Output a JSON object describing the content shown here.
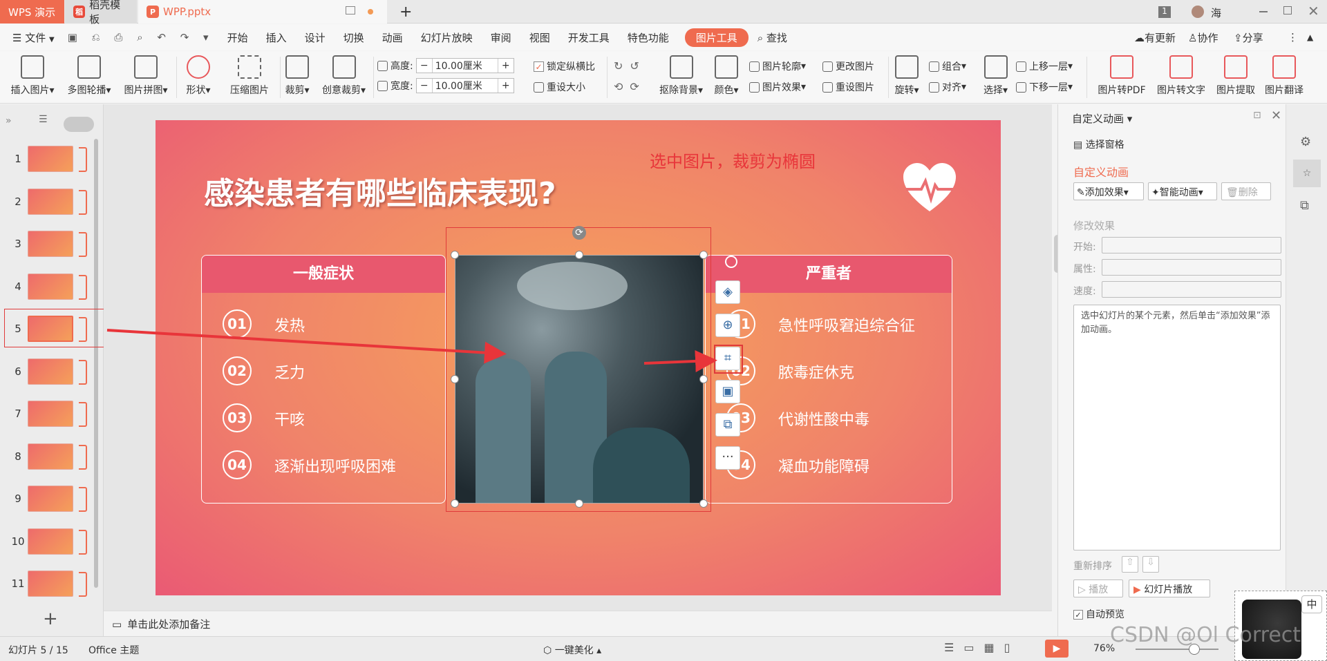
{
  "titlebar": {
    "app_tab": "WPS 演示",
    "tab2": "稻壳模板",
    "tab3": "WPP.pptx",
    "new_tab": "+",
    "badge": "1",
    "user": "海"
  },
  "menu": {
    "file": "文件",
    "items": [
      "开始",
      "插入",
      "设计",
      "切换",
      "动画",
      "幻灯片放映",
      "审阅",
      "视图",
      "开发工具",
      "特色功能"
    ],
    "active": "图片工具",
    "search": "查找",
    "update": "有更新",
    "collab": "协作",
    "share": "分享"
  },
  "ribbon": {
    "insert_pic": "插入图片",
    "carousel": "多图轮播",
    "collage": "图片拼图",
    "shape": "形状",
    "compress": "压缩图片",
    "crop": "裁剪",
    "creative_crop": "创意裁剪",
    "height_label": "高度:",
    "height_value": "10.00厘米",
    "width_label": "宽度:",
    "width_value": "10.00厘米",
    "lock": "锁定纵横比",
    "reset_size": "重设大小",
    "remove_bg": "抠除背景",
    "color": "颜色",
    "outline": "图片轮廓",
    "effect": "图片效果",
    "change_pic": "更改图片",
    "reset_pic": "重设图片",
    "rotate": "旋转",
    "group": "组合",
    "align": "对齐",
    "select": "选择",
    "up": "上移一层",
    "down": "下移一层",
    "to_pdf": "图片转PDF",
    "to_text": "图片转文字",
    "extract": "图片提取",
    "translate": "图片翻译"
  },
  "slides": {
    "numbers": [
      "1",
      "2",
      "3",
      "4",
      "5",
      "6",
      "7",
      "8",
      "9",
      "10",
      "11"
    ],
    "add": "+"
  },
  "slide": {
    "title": "感染患者有哪些临床表现?",
    "annotation": "选中图片，裁剪为椭圆",
    "left_header": "一般症状",
    "left_items": [
      {
        "num": "01",
        "text": "发热"
      },
      {
        "num": "02",
        "text": "乏力"
      },
      {
        "num": "03",
        "text": "干咳"
      },
      {
        "num": "04",
        "text": "逐渐出现呼吸困难"
      }
    ],
    "right_header": "严重者",
    "right_items": [
      {
        "num": "01",
        "text": "急性呼吸窘迫综合征"
      },
      {
        "num": "02",
        "text": "脓毒症休克"
      },
      {
        "num": "03",
        "text": "代谢性酸中毒"
      },
      {
        "num": "04",
        "text": "凝血功能障碍"
      }
    ],
    "more": "···"
  },
  "notes": {
    "placeholder": "单击此处添加备注"
  },
  "pane": {
    "title": "自定义动画",
    "selection": "选择窗格",
    "section": "自定义动画",
    "add_effect": "添加效果",
    "smart": "智能动画",
    "delete": "删除",
    "modify": "修改效果",
    "start": "开始:",
    "property": "属性:",
    "speed": "速度:",
    "hint": "选中幻灯片的某个元素，然后单击“添加效果”添加动画。",
    "reorder": "重新排序",
    "play": "播放",
    "slideshow": "幻灯片播放",
    "autopreview": "自动预览"
  },
  "status": {
    "slide": "幻灯片 5 / 15",
    "theme": "Office 主题",
    "beautify": "一键美化",
    "zoom": "76%",
    "ime": "中"
  },
  "watermark": "CSDN @Ol Correct",
  "colors": {
    "accent": "#e8585b",
    "active_tab": "#ef6b4f",
    "annot": "#e8353a"
  }
}
